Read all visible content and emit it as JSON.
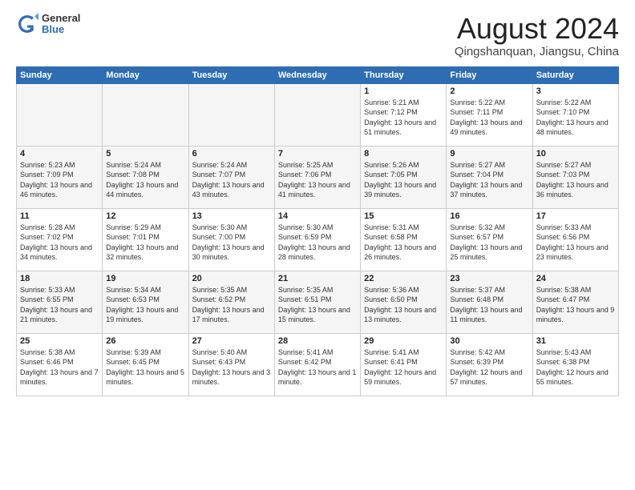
{
  "header": {
    "logo_general": "General",
    "logo_blue": "Blue",
    "month_title": "August 2024",
    "subtitle": "Qingshanquan, Jiangsu, China"
  },
  "days_of_week": [
    "Sunday",
    "Monday",
    "Tuesday",
    "Wednesday",
    "Thursday",
    "Friday",
    "Saturday"
  ],
  "weeks": [
    [
      {
        "day": "",
        "empty": true
      },
      {
        "day": "",
        "empty": true
      },
      {
        "day": "",
        "empty": true
      },
      {
        "day": "",
        "empty": true
      },
      {
        "day": "1",
        "sunrise": "5:21 AM",
        "sunset": "7:12 PM",
        "daylight": "13 hours and 51 minutes."
      },
      {
        "day": "2",
        "sunrise": "5:22 AM",
        "sunset": "7:11 PM",
        "daylight": "13 hours and 49 minutes."
      },
      {
        "day": "3",
        "sunrise": "5:22 AM",
        "sunset": "7:10 PM",
        "daylight": "13 hours and 48 minutes."
      }
    ],
    [
      {
        "day": "4",
        "sunrise": "5:23 AM",
        "sunset": "7:09 PM",
        "daylight": "13 hours and 46 minutes."
      },
      {
        "day": "5",
        "sunrise": "5:24 AM",
        "sunset": "7:08 PM",
        "daylight": "13 hours and 44 minutes."
      },
      {
        "day": "6",
        "sunrise": "5:24 AM",
        "sunset": "7:07 PM",
        "daylight": "13 hours and 43 minutes."
      },
      {
        "day": "7",
        "sunrise": "5:25 AM",
        "sunset": "7:06 PM",
        "daylight": "13 hours and 41 minutes."
      },
      {
        "day": "8",
        "sunrise": "5:26 AM",
        "sunset": "7:05 PM",
        "daylight": "13 hours and 39 minutes."
      },
      {
        "day": "9",
        "sunrise": "5:27 AM",
        "sunset": "7:04 PM",
        "daylight": "13 hours and 37 minutes."
      },
      {
        "day": "10",
        "sunrise": "5:27 AM",
        "sunset": "7:03 PM",
        "daylight": "13 hours and 36 minutes."
      }
    ],
    [
      {
        "day": "11",
        "sunrise": "5:28 AM",
        "sunset": "7:02 PM",
        "daylight": "13 hours and 34 minutes."
      },
      {
        "day": "12",
        "sunrise": "5:29 AM",
        "sunset": "7:01 PM",
        "daylight": "13 hours and 32 minutes."
      },
      {
        "day": "13",
        "sunrise": "5:30 AM",
        "sunset": "7:00 PM",
        "daylight": "13 hours and 30 minutes."
      },
      {
        "day": "14",
        "sunrise": "5:30 AM",
        "sunset": "6:59 PM",
        "daylight": "13 hours and 28 minutes."
      },
      {
        "day": "15",
        "sunrise": "5:31 AM",
        "sunset": "6:58 PM",
        "daylight": "13 hours and 26 minutes."
      },
      {
        "day": "16",
        "sunrise": "5:32 AM",
        "sunset": "6:57 PM",
        "daylight": "13 hours and 25 minutes."
      },
      {
        "day": "17",
        "sunrise": "5:33 AM",
        "sunset": "6:56 PM",
        "daylight": "13 hours and 23 minutes."
      }
    ],
    [
      {
        "day": "18",
        "sunrise": "5:33 AM",
        "sunset": "6:55 PM",
        "daylight": "13 hours and 21 minutes."
      },
      {
        "day": "19",
        "sunrise": "5:34 AM",
        "sunset": "6:53 PM",
        "daylight": "13 hours and 19 minutes."
      },
      {
        "day": "20",
        "sunrise": "5:35 AM",
        "sunset": "6:52 PM",
        "daylight": "13 hours and 17 minutes."
      },
      {
        "day": "21",
        "sunrise": "5:35 AM",
        "sunset": "6:51 PM",
        "daylight": "13 hours and 15 minutes."
      },
      {
        "day": "22",
        "sunrise": "5:36 AM",
        "sunset": "6:50 PM",
        "daylight": "13 hours and 13 minutes."
      },
      {
        "day": "23",
        "sunrise": "5:37 AM",
        "sunset": "6:48 PM",
        "daylight": "13 hours and 11 minutes."
      },
      {
        "day": "24",
        "sunrise": "5:38 AM",
        "sunset": "6:47 PM",
        "daylight": "13 hours and 9 minutes."
      }
    ],
    [
      {
        "day": "25",
        "sunrise": "5:38 AM",
        "sunset": "6:46 PM",
        "daylight": "13 hours and 7 minutes."
      },
      {
        "day": "26",
        "sunrise": "5:39 AM",
        "sunset": "6:45 PM",
        "daylight": "13 hours and 5 minutes."
      },
      {
        "day": "27",
        "sunrise": "5:40 AM",
        "sunset": "6:43 PM",
        "daylight": "13 hours and 3 minutes."
      },
      {
        "day": "28",
        "sunrise": "5:41 AM",
        "sunset": "6:42 PM",
        "daylight": "13 hours and 1 minute."
      },
      {
        "day": "29",
        "sunrise": "5:41 AM",
        "sunset": "6:41 PM",
        "daylight": "12 hours and 59 minutes."
      },
      {
        "day": "30",
        "sunrise": "5:42 AM",
        "sunset": "6:39 PM",
        "daylight": "12 hours and 57 minutes."
      },
      {
        "day": "31",
        "sunrise": "5:43 AM",
        "sunset": "6:38 PM",
        "daylight": "12 hours and 55 minutes."
      }
    ]
  ]
}
